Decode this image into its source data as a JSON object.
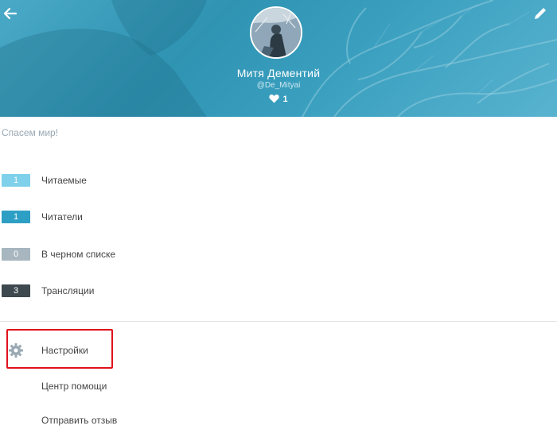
{
  "header": {
    "name": "Митя Дементий",
    "handle": "@De_Mityai",
    "likes_count": "1"
  },
  "status_text": "Спасем мир!",
  "counts": [
    {
      "value": "1",
      "label": "Читаемые",
      "color": "#7fd0ea"
    },
    {
      "value": "1",
      "label": "Читатели",
      "color": "#2e9fc4"
    },
    {
      "value": "0",
      "label": "В черном списке",
      "color": "#a7b6bf"
    },
    {
      "value": "3",
      "label": "Трансляции",
      "color": "#3e484f"
    }
  ],
  "menu": {
    "settings": "Настройки",
    "help": "Центр помощи",
    "feedback": "Отправить отзыв"
  },
  "icons": {
    "back": "arrow-left-icon",
    "edit": "pencil-icon",
    "like": "heart-icon",
    "settings": "gear-icon"
  },
  "colors": {
    "header": "#3a9fbf",
    "highlight": "#e0121b"
  }
}
